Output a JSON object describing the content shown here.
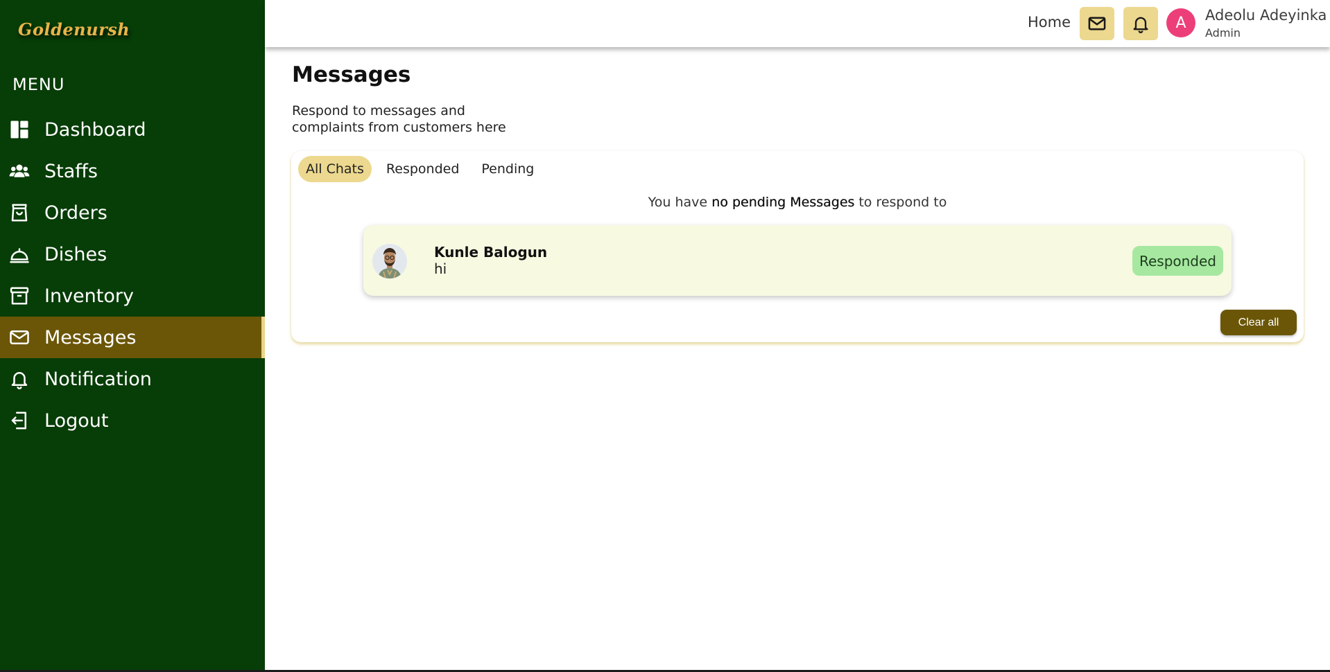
{
  "sidebar": {
    "logo": "Goldenursh",
    "menu_title": "MENU",
    "items": [
      {
        "label": "Dashboard",
        "icon": "dashboard-icon"
      },
      {
        "label": "Staffs",
        "icon": "users-icon"
      },
      {
        "label": "Orders",
        "icon": "shopping-bag-icon"
      },
      {
        "label": "Dishes",
        "icon": "cloche-icon"
      },
      {
        "label": "Inventory",
        "icon": "archive-icon"
      },
      {
        "label": "Messages",
        "icon": "mail-icon",
        "active": true
      },
      {
        "label": "Notification",
        "icon": "bell-icon"
      },
      {
        "label": "Logout",
        "icon": "logout-icon"
      }
    ]
  },
  "header": {
    "home": "Home",
    "mail_icon": "mail-icon",
    "bell_icon": "bell-icon",
    "avatar_letter": "A",
    "user_name": "Adeolu Adeyinka",
    "user_role": "Admin"
  },
  "main": {
    "title": "Messages",
    "subtitle": "Respond to messages and complaints from customers here",
    "tabs": [
      {
        "label": "All Chats",
        "active": true
      },
      {
        "label": "Responded"
      },
      {
        "label": "Pending"
      }
    ],
    "notice": {
      "prefix": "You have ",
      "emphasis": "no pending Messages",
      "suffix": " to respond to"
    },
    "messages": [
      {
        "sender": "Kunle Balogun",
        "text": "hi",
        "status": "Responded"
      }
    ],
    "clear_all": "Clear all"
  },
  "colors": {
    "sidebar_bg": "#073d07",
    "active_nav": "#6b5608",
    "accent_yellow": "#ecd88f",
    "avatar_pink": "#ec3f7a",
    "responded_badge": "#a6e8a0",
    "message_bg": "#f7f9e1"
  }
}
